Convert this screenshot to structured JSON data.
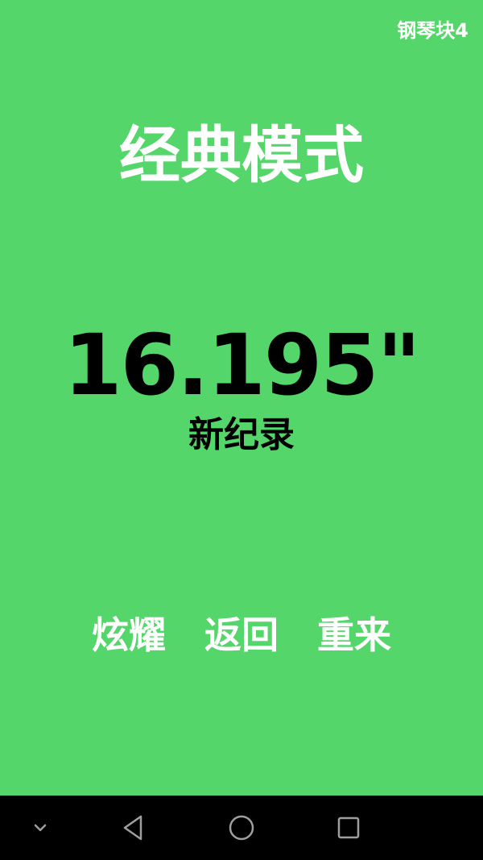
{
  "app": {
    "watermark": "钢琴块4",
    "background_color": "#55d66b"
  },
  "result": {
    "mode_title": "经典模式",
    "score": "16.195\"",
    "record_label": "新纪录"
  },
  "actions": {
    "share_label": "炫耀",
    "back_label": "返回",
    "retry_label": "重来"
  },
  "nav_bar": {
    "icons": [
      "chevron-down-icon",
      "back-triangle-icon",
      "home-circle-icon",
      "recent-square-icon"
    ],
    "icon_color": "#9e9e9e",
    "background_color": "#000000"
  }
}
